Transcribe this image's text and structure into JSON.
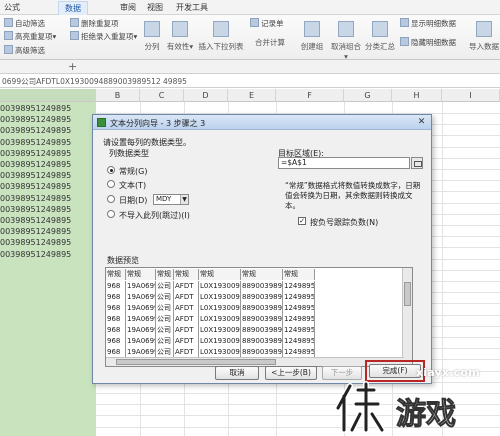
{
  "menu": {
    "tabs": [
      "公式",
      "数据",
      "审阅",
      "视图",
      "开发工具"
    ],
    "active_tab": "数据"
  },
  "ribbon": {
    "row1": [
      "自动筛选",
      "删除重复项"
    ],
    "row2": [
      "高亮重复项",
      "拒绝录入重复项"
    ],
    "row3": [
      "高级筛选"
    ],
    "big": [
      "分列",
      "有效性",
      "插入下拉列表",
      "合并计算",
      "创建组",
      "取消组合",
      "分类汇总",
      "导入数据"
    ],
    "small_mid": [
      "记录单"
    ],
    "small_right1": [
      "显示明细数据"
    ],
    "small_right2": [
      "隐藏明细数据"
    ]
  },
  "formula_bar": {
    "content": "0699公司AFDTL0X1930094889003989512 49895"
  },
  "grid": {
    "columns": [
      "B",
      "C",
      "D",
      "E",
      "F",
      "G",
      "H",
      "I"
    ],
    "colA_value": "00398951249895",
    "colA_rows": 14
  },
  "dialog": {
    "title": "文本分列向导 - 3 步骤之 3",
    "instruction": "请设置每列的数据类型。",
    "column_type_label": "列数据类型",
    "radio_general": "常规(G)",
    "radio_text": "文本(T)",
    "radio_date": "日期(D)",
    "date_format": "MDY",
    "radio_skip": "不导入此列(跳过)(I)",
    "target_label": "目标区域(E):",
    "target_value": "=$A$1",
    "description": "“常规”数据格式将数值转换成数字，日期值会转换为日期，其余数据则转换成文本。",
    "negative_checkbox": "按负号跟踪负数(N)",
    "negative_checked": true,
    "preview_label": "数据预览",
    "preview_headers": [
      "常规",
      "常规",
      "常规",
      "常规",
      "常规",
      "常规",
      "常规"
    ],
    "preview_rows": [
      [
        "968",
        "19A0699",
        "公司",
        "AFDT",
        "L0X1930094",
        "8890039895",
        "1249895"
      ],
      [
        "968",
        "19A0699",
        "公司",
        "AFDT",
        "L0X1930094",
        "8890039895",
        "1249895"
      ],
      [
        "968",
        "19A0699",
        "公司",
        "AFDT",
        "L0X1930094",
        "8890039895",
        "1249895"
      ],
      [
        "968",
        "19A0699",
        "公司",
        "AFDT",
        "L0X1930094",
        "8890039895",
        "1249895"
      ],
      [
        "968",
        "19A0699",
        "公司",
        "AFDT",
        "L0X1930094",
        "8890039895",
        "1249895"
      ],
      [
        "968",
        "19A0699",
        "公司",
        "AFDT",
        "L0X1930094",
        "8890039895",
        "1249895"
      ],
      [
        "968",
        "19A0699",
        "公司",
        "AFDT",
        "L0X1930094",
        "8890039895",
        "1249895"
      ],
      [
        "968",
        "19A0699",
        "公司",
        "AFDT",
        "L0X1930094",
        "8890039895",
        "1249895"
      ]
    ],
    "btn_cancel": "取消",
    "btn_back": "<上一步(B)",
    "btn_next": "下一步",
    "btn_finish": "完成(F)"
  },
  "watermark": {
    "url": "xiayx.com",
    "text": "游戏"
  }
}
